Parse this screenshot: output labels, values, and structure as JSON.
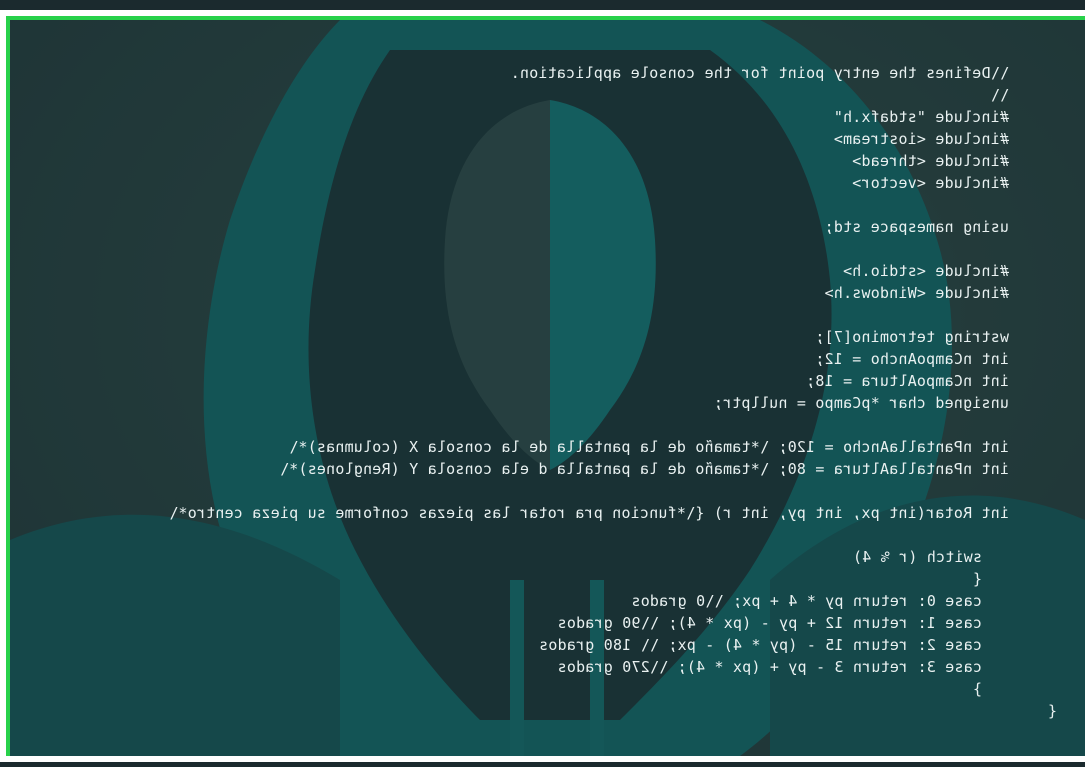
{
  "console": {
    "lines": [
      "\\\\Defines the entry point for the console application.",
      "\\\\",
      "#include \"stdafx.h\"",
      "#include <iostream>",
      "#include <thread>",
      "#include <vector>",
      "using namespace std;",
      "#include <stdio.h>",
      "#include <Windows.h>",
      "wstring tetromino[7];",
      "int nCampoAncho = 12;",
      "int nCampoAltura = 18;",
      "unsigned char *pCampo = nullptr;",
      "int nPantallaAncho = 120; \\*tamaño de la pantalla de la consola X (columnas)*\\",
      "int nPantallaAltura = 80; \\*tamaño de la pantalla d ela consola Y (Renglones)*\\",
      "int Rotar(int px, int py, int r) {\\*funcion pra rotar las piezas conforme su pieza centro*\\",
      "switch (r % 4)",
      "{",
      "case 0: return py * 4 + px; \\\\0 grados",
      "case 1: return 12 + py - (px * 4); \\\\90 grados",
      "case 2: return 15 - (py * 4) - px; \\\\ 180 grados",
      "case 3: return 3 - py + (px * 4); \\\\270 grados",
      "}",
      "{"
    ]
  },
  "colors": {
    "background": "#28413f",
    "hood": "#0c7c7c",
    "frame_green": "#28d14a",
    "text": "#e9f1f1"
  }
}
